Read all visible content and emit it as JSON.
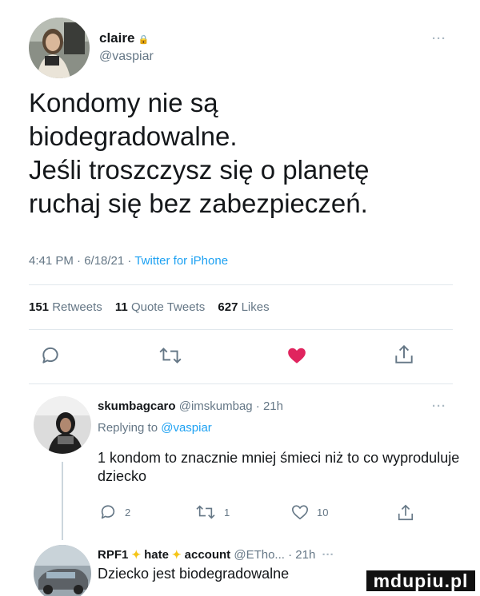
{
  "main_tweet": {
    "display_name": "claire",
    "lock_glyph": "🔒",
    "handle": "@vaspiar",
    "more_label": "···",
    "text_lines": [
      "Kondomy nie są",
      "biodegradowalne.",
      "Jeśli troszczysz się o planetę",
      "ruchaj się bez zabezpieczeń."
    ],
    "timestamp": "4:41 PM · 6/18/21 · ",
    "source": "Twitter for iPhone",
    "stats": {
      "retweets_count": "151",
      "retweets_label": "Retweets",
      "quotes_count": "11",
      "quotes_label": "Quote Tweets",
      "likes_count": "627",
      "likes_label": "Likes"
    },
    "actions": [
      "reply-icon",
      "retweet-icon",
      "like-icon-filled",
      "share-icon"
    ],
    "like_color": "#e0245e"
  },
  "reply_1": {
    "display_name": "skumbagcaro",
    "handle_time": "@imskumbag · 21h",
    "replying_prefix": "Replying to ",
    "replying_to": "@vaspiar",
    "more_label": "···",
    "text": "1 kondom to znacznie mniej śmieci niż to co wyproduluje dziecko",
    "reply_count": "2",
    "retweet_count": "1",
    "like_count": "10"
  },
  "reply_2": {
    "name_a": "RPF1",
    "name_b": "hate",
    "name_c": "account",
    "spark_glyph": "✦",
    "handle_time": "@ETho... · 21h",
    "more_label": "···",
    "text": "Dziecko jest biodegradowalne"
  },
  "watermark": "mdupiu.pl",
  "colors": {
    "accent": "#1da1f2",
    "muted": "#657786",
    "text": "#14171a"
  }
}
